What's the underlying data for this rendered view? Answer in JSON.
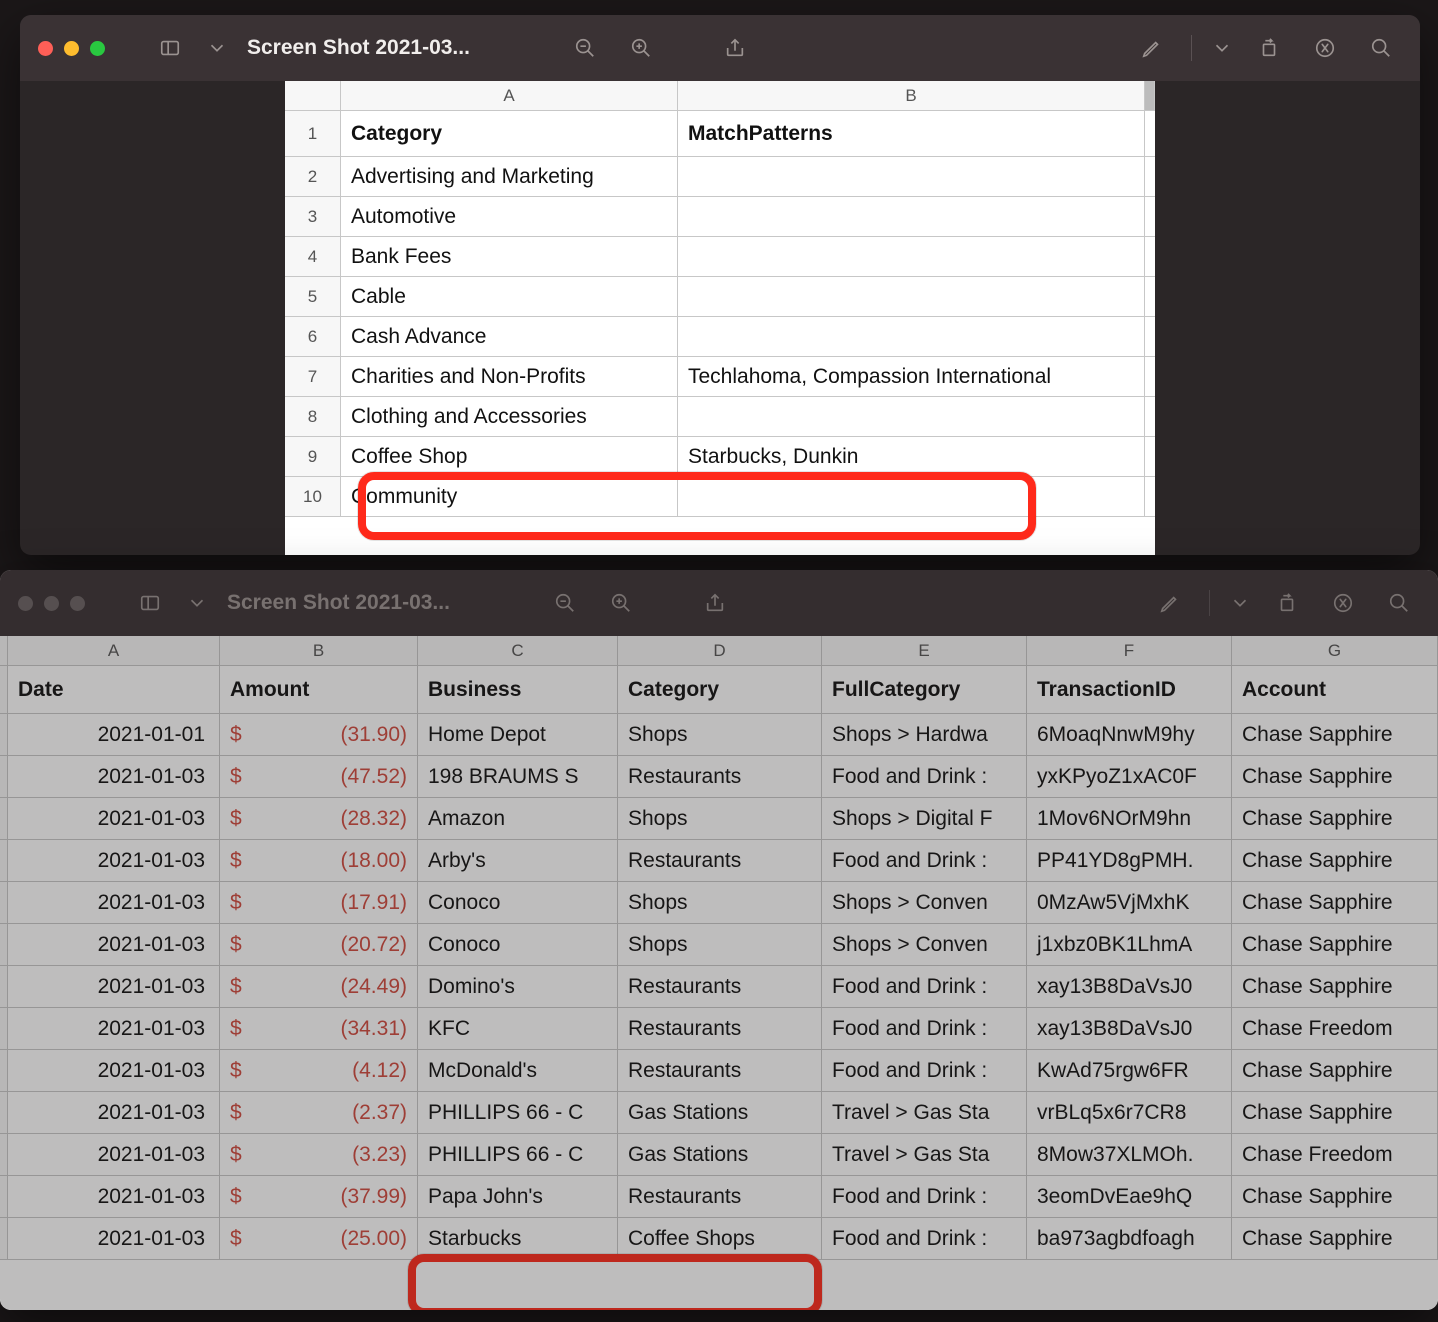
{
  "window_top": {
    "title": "Screen Shot 2021-03...",
    "columns": {
      "A": "A",
      "B": "B"
    },
    "headers": {
      "category": "Category",
      "match": "MatchPatterns"
    },
    "rows": [
      {
        "n": "1"
      },
      {
        "n": "2",
        "a": "Advertising and Marketing",
        "b": ""
      },
      {
        "n": "3",
        "a": "Automotive",
        "b": ""
      },
      {
        "n": "4",
        "a": "Bank Fees",
        "b": ""
      },
      {
        "n": "5",
        "a": "Cable",
        "b": ""
      },
      {
        "n": "6",
        "a": "Cash Advance",
        "b": ""
      },
      {
        "n": "7",
        "a": "Charities and Non-Profits",
        "b": "Techlahoma, Compassion International"
      },
      {
        "n": "8",
        "a": "Clothing and Accessories",
        "b": ""
      },
      {
        "n": "9",
        "a": "Coffee Shop",
        "b": "Starbucks, Dunkin"
      },
      {
        "n": "10",
        "a": "Community",
        "b": ""
      }
    ],
    "currency_symbol": "$"
  },
  "window_bottom": {
    "title": "Screen Shot 2021-03...",
    "columns": {
      "A": "A",
      "B": "B",
      "C": "C",
      "D": "D",
      "E": "E",
      "F": "F",
      "G": "G"
    },
    "headers": {
      "date": "Date",
      "amount": "Amount",
      "business": "Business",
      "category": "Category",
      "fullcategory": "FullCategory",
      "txid": "TransactionID",
      "account": "Account"
    },
    "rows": [
      {
        "date": "2021-01-01",
        "amount": "(31.90)",
        "business": "Home Depot",
        "category": "Shops",
        "full": "Shops > Hardwa",
        "tx": "6MoaqNnwM9hy",
        "acct": "Chase Sapphire"
      },
      {
        "date": "2021-01-03",
        "amount": "(47.52)",
        "business": "198 BRAUMS S",
        "category": "Restaurants",
        "full": "Food and Drink :",
        "tx": "yxKPyoZ1xAC0F",
        "acct": "Chase Sapphire"
      },
      {
        "date": "2021-01-03",
        "amount": "(28.32)",
        "business": "Amazon",
        "category": "Shops",
        "full": "Shops > Digital F",
        "tx": "1Mov6NOrM9hn",
        "acct": "Chase Sapphire"
      },
      {
        "date": "2021-01-03",
        "amount": "(18.00)",
        "business": "Arby's",
        "category": "Restaurants",
        "full": "Food and Drink :",
        "tx": "PP41YD8gPMH.",
        "acct": "Chase Sapphire"
      },
      {
        "date": "2021-01-03",
        "amount": "(17.91)",
        "business": "Conoco",
        "category": "Shops",
        "full": "Shops > Conven",
        "tx": "0MzAw5VjMxhK",
        "acct": "Chase Sapphire"
      },
      {
        "date": "2021-01-03",
        "amount": "(20.72)",
        "business": "Conoco",
        "category": "Shops",
        "full": "Shops > Conven",
        "tx": "j1xbz0BK1LhmA",
        "acct": "Chase Sapphire"
      },
      {
        "date": "2021-01-03",
        "amount": "(24.49)",
        "business": "Domino's",
        "category": "Restaurants",
        "full": "Food and Drink :",
        "tx": "xay13B8DaVsJ0",
        "acct": "Chase Sapphire"
      },
      {
        "date": "2021-01-03",
        "amount": "(34.31)",
        "business": "KFC",
        "category": "Restaurants",
        "full": "Food and Drink :",
        "tx": "xay13B8DaVsJ0",
        "acct": "Chase Freedom"
      },
      {
        "date": "2021-01-03",
        "amount": "(4.12)",
        "business": "McDonald's",
        "category": "Restaurants",
        "full": "Food and Drink :",
        "tx": "KwAd75rgw6FR",
        "acct": "Chase Sapphire"
      },
      {
        "date": "2021-01-03",
        "amount": "(2.37)",
        "business": "PHILLIPS 66 - C",
        "category": "Gas Stations",
        "full": "Travel > Gas Sta",
        "tx": "vrBLq5x6r7CR8",
        "acct": "Chase Sapphire"
      },
      {
        "date": "2021-01-03",
        "amount": "(3.23)",
        "business": "PHILLIPS 66 - C",
        "category": "Gas Stations",
        "full": "Travel > Gas Sta",
        "tx": "8Mow37XLMOh.",
        "acct": "Chase Freedom"
      },
      {
        "date": "2021-01-03",
        "amount": "(37.99)",
        "business": "Papa John's",
        "category": "Restaurants",
        "full": "Food and Drink :",
        "tx": "3eomDvEae9hQ",
        "acct": "Chase Sapphire"
      },
      {
        "date": "2021-01-03",
        "amount": "(25.00)",
        "business": "Starbucks",
        "category": "Coffee Shops",
        "full": "Food and Drink :",
        "tx": "ba973agbdfoagh",
        "acct": "Chase Sapphire"
      }
    ]
  }
}
